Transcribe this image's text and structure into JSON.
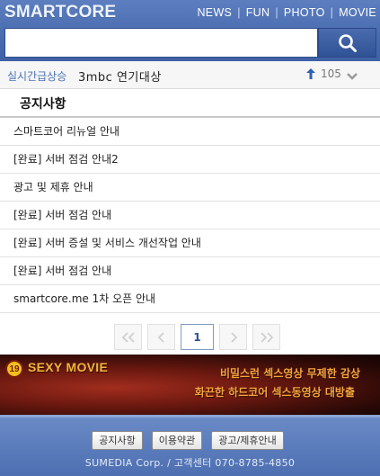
{
  "header": {
    "logo": "SMARTCORE",
    "nav": [
      "NEWS",
      "FUN",
      "PHOTO",
      "MOVIE"
    ],
    "search_placeholder": ""
  },
  "trending": {
    "label": "실시간급상승",
    "keyword": "3mbc 연기대상",
    "count": "105"
  },
  "notices": {
    "title": "공지사항",
    "items": [
      "스마트코어 리뉴얼 안내",
      "[완료] 서버 점검 안내2",
      "광고 및 제휴 안내",
      "[완료] 서버 점검 안내",
      "[완료] 서버 증설 및 서비스 개선작업 안내",
      "[완료] 서버 점검 안내",
      "smartcore.me 1차 오픈 안내"
    ]
  },
  "pagination": {
    "current_page": "1"
  },
  "banner": {
    "badge": "19",
    "brand": "SEXY MOVIE",
    "line1": "비밀스런 섹스영상 무제한 감상",
    "line2": "화끈한 하드코어 섹스동영상 대방출"
  },
  "footer": {
    "links": [
      "공지사항",
      "이용약관",
      "광고/제휴안내"
    ],
    "copyright": "SUMEDIA Corp. / 고객센터 070-8785-4850"
  },
  "colors": {
    "header_blue": "#4a6db0",
    "trend_label": "#4b72b8",
    "banner_text": "#f5a53b"
  }
}
